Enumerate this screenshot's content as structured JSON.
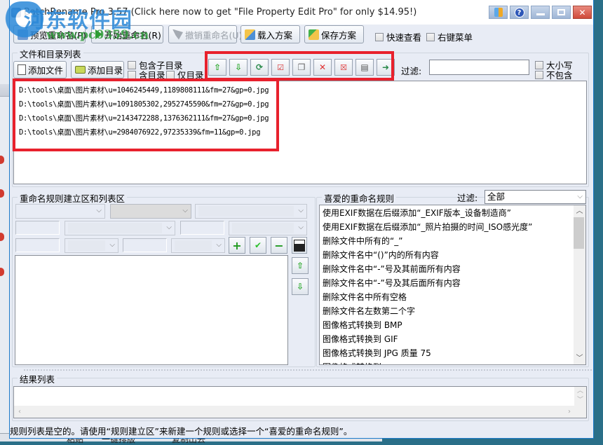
{
  "window": {
    "title": "BatchRename Pro 3.57  (Click here now to get \"File Property Edit Pro\" for only $14.95!)",
    "caption_buttons": [
      "app-icon",
      "help-icon",
      "minimize-icon",
      "maximize-icon",
      "close-icon"
    ]
  },
  "watermark": {
    "name": "河东软件园",
    "url": "www.pc0359.cn"
  },
  "toolbar": {
    "preview": "预览重命名(P)",
    "start": "开始重命名(R)",
    "undo": "撤销重命名(U)",
    "load": "载入方案",
    "save": "保存方案",
    "quick_view": "快速查看",
    "context_menu": "右键菜单"
  },
  "files_group": {
    "title": "文件和目录列表",
    "add_file": "添加文件",
    "add_folder": "添加目录",
    "include_subdirs": "包含子目录",
    "include_dirs": "含目录",
    "dirs_only": "仅目录",
    "filter_label": "过滤:",
    "filter_value": "",
    "case_sensitive": "大小写",
    "exclude": "不包含",
    "action_icons": [
      "move-up-icon",
      "move-down-icon",
      "refresh-icon",
      "check-icon",
      "copy-icon",
      "delete-icon",
      "remove-selected-icon",
      "paste-icon",
      "export-icon"
    ],
    "files": [
      "D:\\tools\\桌面\\图片素材\\u=1046245449,1189808111&fm=27&gp=0.jpg",
      "D:\\tools\\桌面\\图片素材\\u=1091805302,2952745590&fm=27&gp=0.jpg",
      "D:\\tools\\桌面\\图片素材\\u=2143472288,1376362111&fm=27&gp=0.jpg",
      "D:\\tools\\桌面\\图片素材\\u=2984076922,97235339&fm=11&gp=0.jpg"
    ]
  },
  "rules_group": {
    "title": "重命名规则建立区和列表区",
    "add_icon": "+",
    "apply_icon": "✔",
    "remove_icon": "−",
    "save_icon": "floppy"
  },
  "favorites": {
    "title": "喜爱的重命名规则",
    "filter_label": "过滤:",
    "filter_value": "全部",
    "items": [
      "使用EXIF数据在后缀添加“_EXIF版本_设备制造商”",
      "使用EXIF数据在后缀添加“_照片拍摄的时间_ISO感光度”",
      "删除文件中所有的“_”",
      "删除文件名中“()”内的所有内容",
      "删除文件名中“-”号及其前面所有内容",
      "删除文件名中“-”号及其后面所有内容",
      "删除文件名中所有空格",
      "删除文件名左数第二个字",
      "图像格式转换到 BMP",
      "图像格式转换到 GIF",
      "图像格式转换到 JPG 质量 75",
      "图像格式转换到..."
    ]
  },
  "results": {
    "title": "结果列表"
  },
  "status": "规则列表是空的。请使用“规则建立区”来新建一个规则或选择一个“喜爱的重命名规则”。",
  "background": {
    "bottom_labels": [
      "粘贴",
      "一键排版",
      "复制出去"
    ]
  },
  "colors": {
    "highlight_red": "#e8212d",
    "title_blue": "#1d7ac9",
    "window_bg": "#e8ecf5"
  }
}
